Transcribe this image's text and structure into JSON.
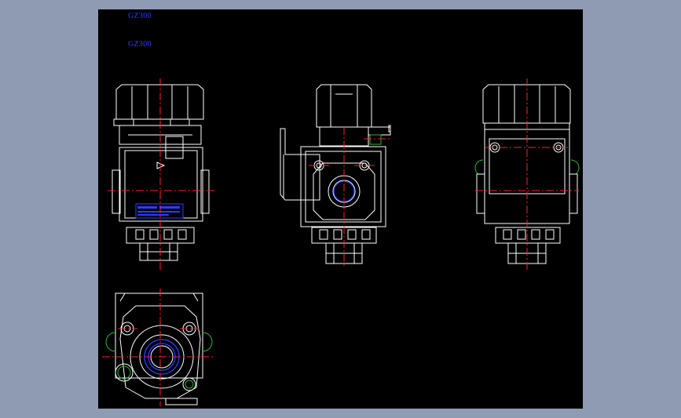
{
  "labels": {
    "title_1": "GZ300",
    "title_2": "GZ300"
  },
  "colors": {
    "background_outer": "#8f9bb1",
    "canvas": "#000000",
    "line": "#ffffff",
    "centerline": "#ff2020",
    "blue": "#2f3cff",
    "green": "#2fb52f"
  },
  "views": [
    "front-view",
    "side-view",
    "right-view",
    "bottom-view"
  ]
}
